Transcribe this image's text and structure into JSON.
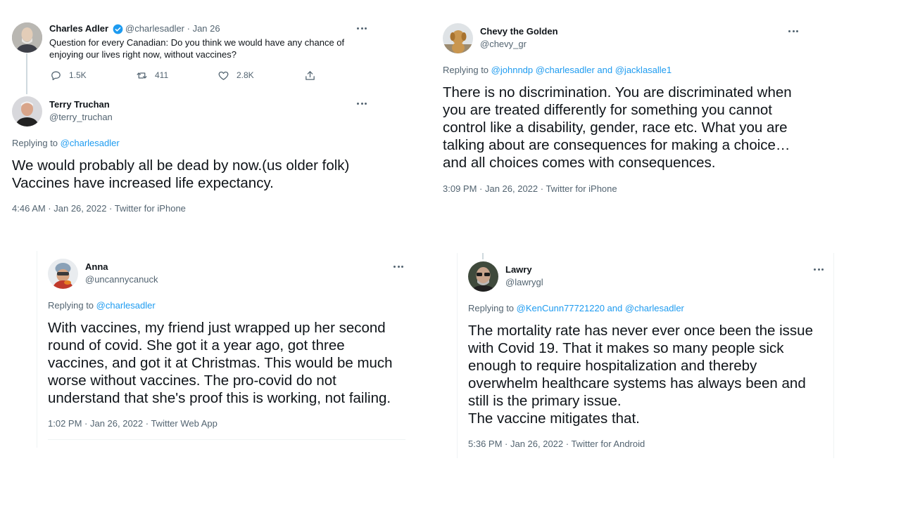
{
  "tweet_top": {
    "author": "Charles Adler",
    "handle_line": "@charlesadler · Jan 26",
    "text_lines": [
      "Question for every Canadian: Do you think we would have any chance of",
      "enjoying our lives right now, without vaccines?"
    ],
    "replies": "1.5K",
    "retweets": "411",
    "likes": "2.8K"
  },
  "reply_terry": {
    "author": "Terry Truchan",
    "handle": "@terry_truchan",
    "replying_prefix": "Replying to",
    "replying_to": "@charlesadler",
    "text_lines": [
      "We would probably all be dead by now.(us older folk)",
      "Vaccines have increased life expectancy."
    ],
    "meta": "4:46 AM · Jan 26, 2022 · Twitter for iPhone"
  },
  "reply_chevy": {
    "author": "Chevy the Golden",
    "handle": "@chevy_gr",
    "replying_prefix": "Replying to",
    "replying_to_1": "@johnndp",
    "replying_to_2": "@charlesadler",
    "replying_and": "and",
    "replying_to_3": "@jacklasalle1",
    "text_lines": [
      "There is no discrimination. You are discriminated when",
      "you are treated differently for something you cannot",
      "control like a disability, gender, race etc. What you are",
      "talking about are consequences for making a choice…",
      "and all choices comes with consequences."
    ],
    "meta": "3:09 PM · Jan 26, 2022 · Twitter for iPhone"
  },
  "reply_anna": {
    "author": "Anna",
    "handle": "@uncannycanuck",
    "replying_prefix": "Replying to",
    "replying_to": "@charlesadler",
    "text_lines": [
      "With vaccines, my friend just wrapped up her second",
      "round of covid. She got it a year ago, got three",
      "vaccines, and got it at Christmas. This would be much",
      "worse without vaccines. The pro-covid do not",
      "understand that she's proof this is working, not failing."
    ],
    "meta": "1:02 PM · Jan 26, 2022 · Twitter Web App"
  },
  "reply_lawry": {
    "author": "Lawry",
    "handle": "@lawrygl",
    "replying_prefix": "Replying to",
    "replying_to_1": "@KenCunn77721220",
    "replying_and": "and",
    "replying_to_2": "@charlesadler",
    "text_lines": [
      "The mortality rate has never ever once been the issue",
      "with Covid 19. That it makes so many people sick",
      "enough to require hospitalization and thereby",
      "overwhelm healthcare systems has always been and",
      "still is the primary issue.",
      "The vaccine mitigates that."
    ],
    "meta": "5:36 PM · Jan 26, 2022 · Twitter for Android"
  },
  "icons": {
    "verified": "verified-badge-icon",
    "more": "more-icon",
    "reply": "reply-icon",
    "retweet": "retweet-icon",
    "like": "heart-icon",
    "share": "share-icon"
  },
  "colors": {
    "link": "#1d9bf0",
    "muted": "#536471",
    "text": "#0f1419"
  }
}
